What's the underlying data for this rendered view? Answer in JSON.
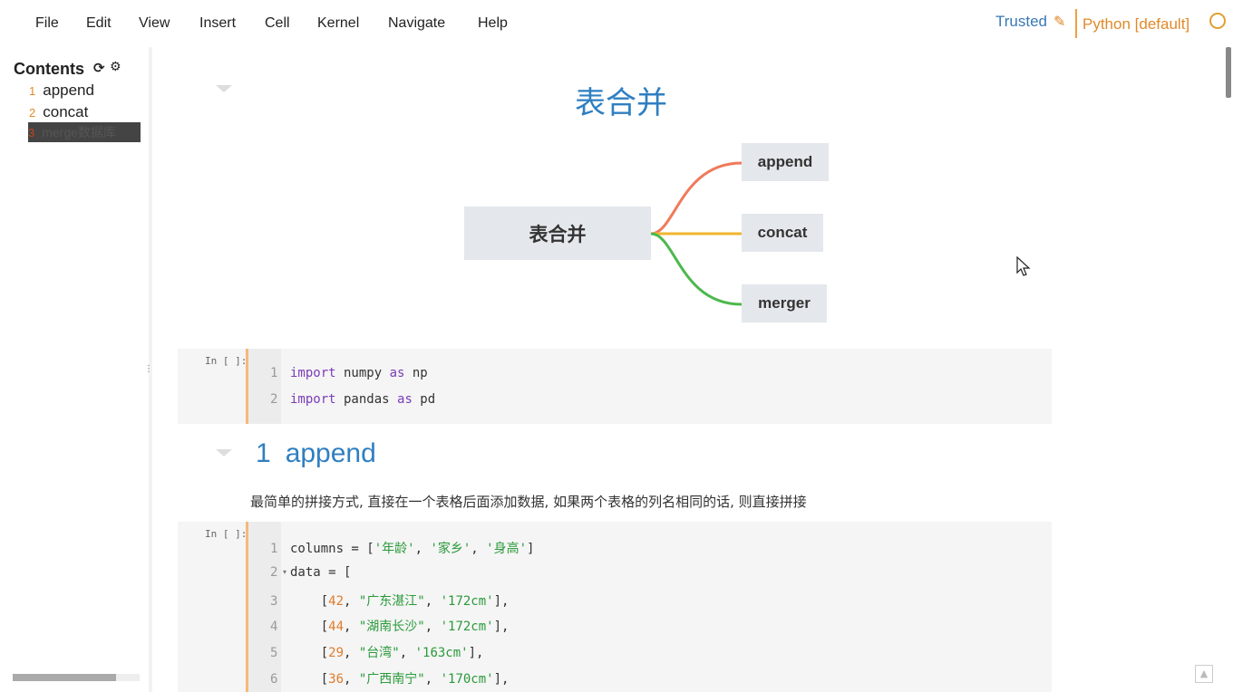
{
  "menu": {
    "items": [
      "File",
      "Edit",
      "View",
      "Insert",
      "Cell",
      "Kernel",
      "Navigate",
      "Help"
    ],
    "trusted_label": "Trusted",
    "kernel_label": "Python [default]"
  },
  "toc": {
    "title": "Contents",
    "items": [
      {
        "num": "1",
        "label": "append"
      },
      {
        "num": "2",
        "label": "concat"
      },
      {
        "num": "3",
        "label": "merge数据库"
      }
    ]
  },
  "notebook": {
    "title": "表合并",
    "mindmap": {
      "root": "表合并",
      "branches": [
        "append",
        "concat",
        "merger"
      ],
      "colors": [
        "#ef7a5a",
        "#f2b530",
        "#4cb84c"
      ]
    },
    "cell1": {
      "prompt": "In [ ]:",
      "lines": [
        {
          "n": "1",
          "kw": "import",
          "a": " numpy ",
          "kw2": "as",
          "b": " np"
        },
        {
          "n": "2",
          "kw": "import",
          "a": " pandas ",
          "kw2": "as",
          "b": " pd"
        }
      ]
    },
    "section1": {
      "num": "1",
      "title": "append"
    },
    "paragraph": "最简单的拼接方式, 直接在一个表格后面添加数据, 如果两个表格的列名相同的话, 则直接拼接",
    "cell2": {
      "prompt": "In [ ]:",
      "line1": {
        "n": "1",
        "pre": "columns = [",
        "s1": "'年龄'",
        "c1": ", ",
        "s2": "'家乡'",
        "c2": ", ",
        "s3": "'身高'",
        "post": "]"
      },
      "line2": {
        "n": "2",
        "text": "data = ["
      },
      "rows": [
        {
          "n": "3",
          "age": "42",
          "city": "\"广东湛江\"",
          "height": "'172cm'"
        },
        {
          "n": "4",
          "age": "44",
          "city": "\"湖南长沙\"",
          "height": "'172cm'"
        },
        {
          "n": "5",
          "age": "29",
          "city": "\"台湾\"",
          "height": "'163cm'"
        },
        {
          "n": "6",
          "age": "36",
          "city": "\"广西南宁\"",
          "height": "'170cm'"
        }
      ]
    }
  }
}
